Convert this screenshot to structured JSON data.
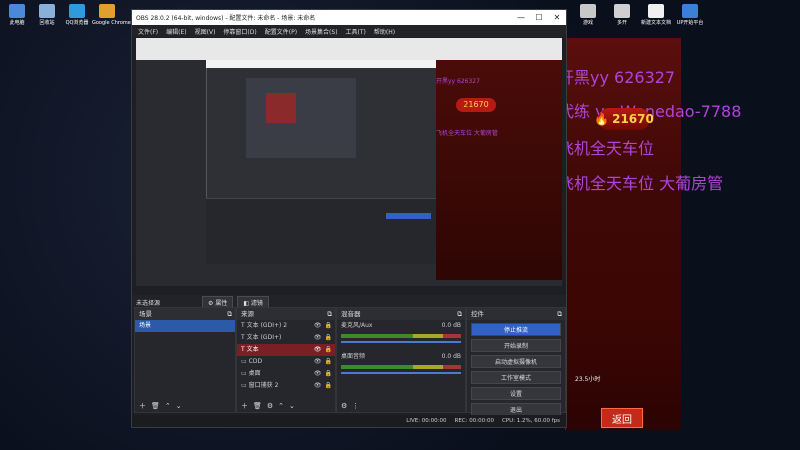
{
  "desktop": {
    "icons_left": [
      {
        "label": "此电脑",
        "icon": "computer-icon",
        "color": "#4a8ad8"
      },
      {
        "label": "回收站",
        "icon": "recycle-bin-icon",
        "color": "#8ab0d8"
      },
      {
        "label": "QQ浏览器",
        "icon": "qq-browser-icon",
        "color": "#2e9be0"
      },
      {
        "label": "Google Chrome",
        "icon": "chrome-icon",
        "color": "#e0a02e"
      }
    ],
    "icons_right": [
      {
        "label": "游戏",
        "icon": "game-icon",
        "color": "#c8c8c8"
      },
      {
        "label": "多开",
        "icon": "multi-open-icon",
        "color": "#d0d0d0"
      },
      {
        "label": "新建文本文档",
        "icon": "text-doc-icon",
        "color": "#f0f0f0"
      },
      {
        "label": "UP开始平台",
        "icon": "up-platform-icon",
        "color": "#3a80d8"
      }
    ]
  },
  "game": {
    "overlay_lines": [
      "开黑yy    626327",
      "代练 v : Wenedao-7788",
      "飞机全天车位",
      "飞机全天车位  大葡房管"
    ],
    "score": "21670",
    "back_button": "返回",
    "mini_value": "23.5小时"
  },
  "obs": {
    "title": "OBS 28.0.2 (64-bit, windows) - 配置文件: 未命名 - 场景: 未命名",
    "menu": [
      "文件(F)",
      "编辑(E)",
      "视图(V)",
      "停靠窗口(D)",
      "配置文件(P)",
      "场景集合(S)",
      "工具(T)",
      "帮助(H)"
    ],
    "toolbar": {
      "no_source": "未选择源",
      "properties": "属性",
      "filters": "滤镜"
    },
    "scenes": {
      "title": "场景",
      "items": [
        "场景"
      ]
    },
    "sources": {
      "title": "来源",
      "items": [
        "文本 (GDI+) 2",
        "文本 (GDI+)",
        "文本",
        "CDD",
        "桌面",
        "窗口捕获 2"
      ]
    },
    "mixer": {
      "title": "混音器",
      "channels": [
        {
          "name": "麦克风/Aux",
          "db": "0.0 dB"
        },
        {
          "name": "桌面音频",
          "db": "0.0 dB"
        }
      ]
    },
    "controls": {
      "title": "控件",
      "buttons": [
        "停止推流",
        "开始录制",
        "启动虚拟摄像机",
        "工作室模式",
        "设置",
        "退出"
      ]
    },
    "status": {
      "live": "LIVE: 00:00:00",
      "rec": "REC: 00:00:00",
      "cpu": "CPU: 1.2%, 60.00 fps"
    }
  }
}
